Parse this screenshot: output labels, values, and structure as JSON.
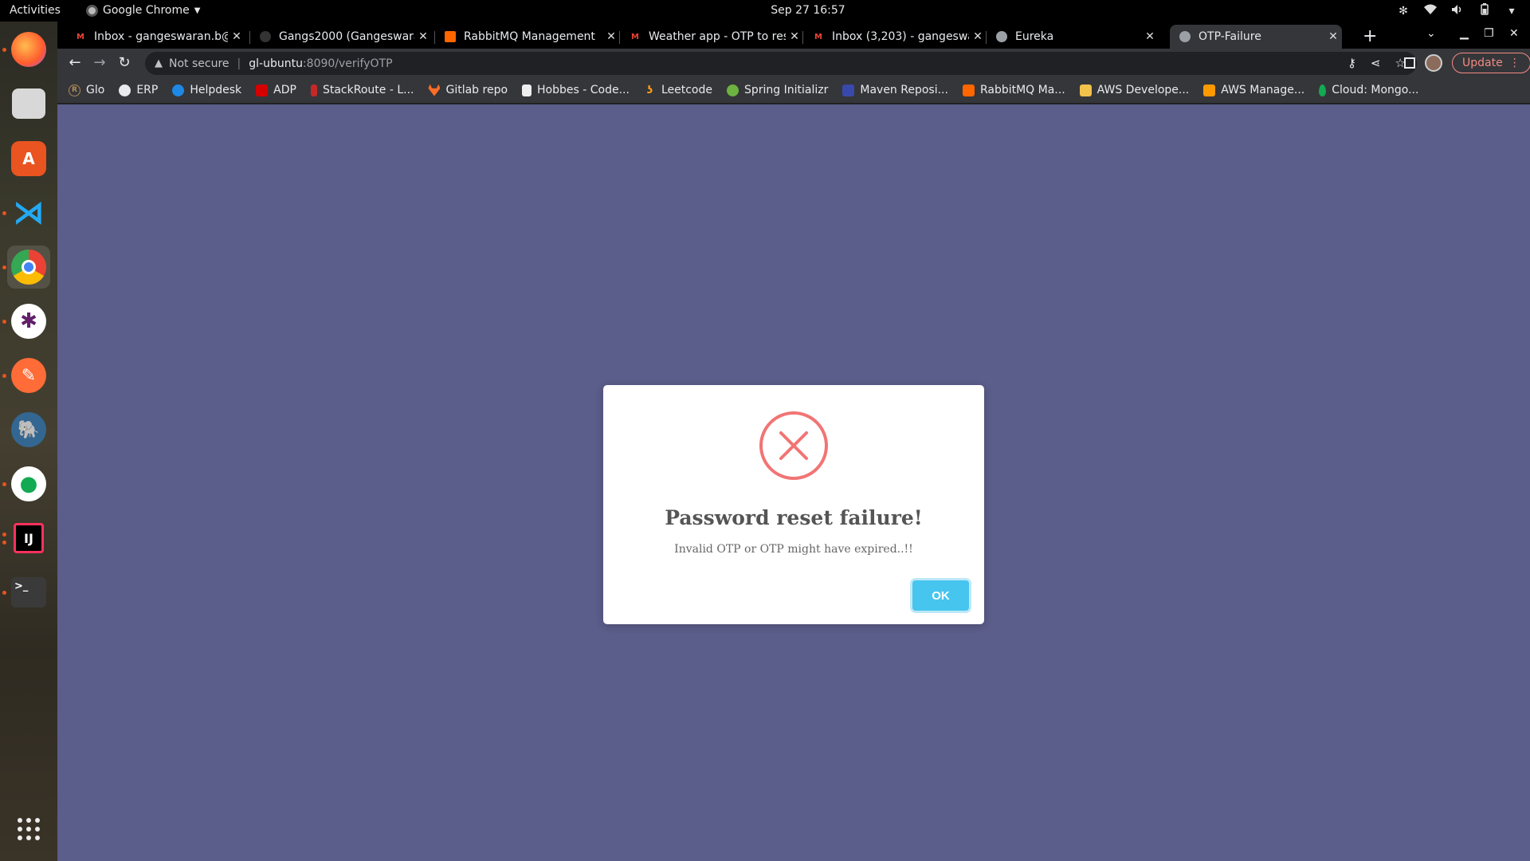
{
  "topbar": {
    "activities": "Activities",
    "app_name": "Google Chrome",
    "clock": "Sep 27  16:57"
  },
  "dock": {
    "apps": [
      {
        "name": "firefox-icon"
      },
      {
        "name": "files-icon"
      },
      {
        "name": "software-center-icon"
      },
      {
        "name": "vscode-icon"
      },
      {
        "name": "chrome-icon",
        "active": true
      },
      {
        "name": "slack-icon"
      },
      {
        "name": "postman-icon"
      },
      {
        "name": "postgresql-icon"
      },
      {
        "name": "mongodb-compass-icon"
      },
      {
        "name": "intellij-icon",
        "label": "IJ"
      },
      {
        "name": "terminal-icon",
        "label": ">_"
      }
    ]
  },
  "tabs": [
    {
      "title": "Inbox - gangeswaran.b@",
      "fav": "M",
      "color": "#ea4335"
    },
    {
      "title": "Gangs2000 (Gangeswara",
      "fav": "",
      "color": "#333333"
    },
    {
      "title": "RabbitMQ Management",
      "fav": "",
      "color": "#ff6600"
    },
    {
      "title": "Weather app - OTP to res",
      "fav": "M",
      "color": "#ea4335"
    },
    {
      "title": "Inbox (3,203) - gangeswa",
      "fav": "M",
      "color": "#ea4335"
    },
    {
      "title": "Eureka",
      "fav": "",
      "color": "#9aa0a6"
    },
    {
      "title": "OTP-Failure",
      "fav": "",
      "color": "#9aa0a6",
      "active": true
    }
  ],
  "toolbar": {
    "not_secure": "Not secure",
    "url_host": "gl-ubuntu",
    "url_path": ":8090/verifyOTP",
    "update_label": "Update"
  },
  "bookmarks": [
    {
      "label": "Glo",
      "color": "#8e6a2a"
    },
    {
      "label": "ERP",
      "color": "#ffffff"
    },
    {
      "label": "Helpdesk",
      "color": "#1e88e5"
    },
    {
      "label": "ADP",
      "color": "#d50000"
    },
    {
      "label": "StackRoute - L...",
      "color": "#c62828"
    },
    {
      "label": "Gitlab repo",
      "color": "#fc6d26"
    },
    {
      "label": "Hobbes - Code...",
      "color": "#eeeeee"
    },
    {
      "label": "Leetcode",
      "color": "#ffa116"
    },
    {
      "label": "Spring Initializr",
      "color": "#6db33f"
    },
    {
      "label": "Maven Reposi...",
      "color": "#3949ab"
    },
    {
      "label": "RabbitMQ Ma...",
      "color": "#ff6600"
    },
    {
      "label": "AWS Develope...",
      "color": "#f0c14b"
    },
    {
      "label": "AWS Manage...",
      "color": "#ff9900"
    },
    {
      "label": "Cloud: Mongo...",
      "color": "#13aa52"
    }
  ],
  "modal": {
    "title": "Password reset failure!",
    "message": "Invalid OTP or OTP might have expired..!!",
    "ok_label": "OK",
    "error_color": "#f27474",
    "button_color": "#46c5ef"
  },
  "colors": {
    "page_background": "#5b5d8a"
  }
}
